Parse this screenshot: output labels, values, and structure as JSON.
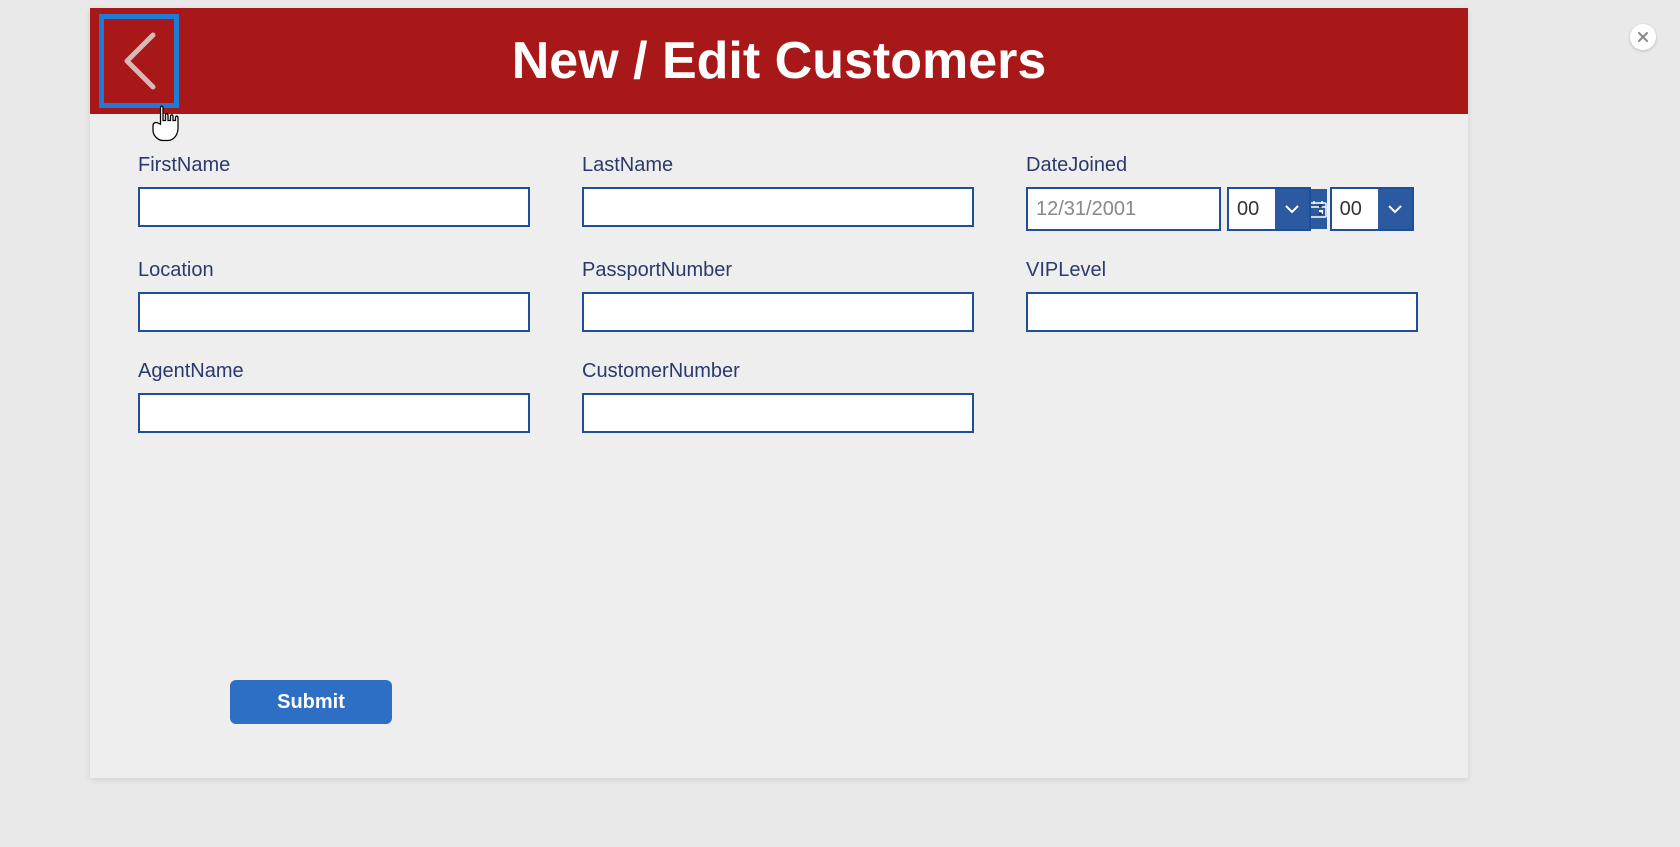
{
  "header": {
    "title": "New / Edit Customers"
  },
  "form": {
    "firstName": {
      "label": "FirstName",
      "value": ""
    },
    "lastName": {
      "label": "LastName",
      "value": ""
    },
    "dateJoined": {
      "label": "DateJoined",
      "date_value": "12/31/2001",
      "hour_value": "00",
      "minute_value": "00",
      "separator": ":"
    },
    "location": {
      "label": "Location",
      "value": ""
    },
    "passportNumber": {
      "label": "PassportNumber",
      "value": ""
    },
    "vipLevel": {
      "label": "VIPLevel",
      "value": ""
    },
    "agentName": {
      "label": "AgentName",
      "value": ""
    },
    "customerNumber": {
      "label": "CustomerNumber",
      "value": ""
    }
  },
  "buttons": {
    "submit": "Submit"
  }
}
